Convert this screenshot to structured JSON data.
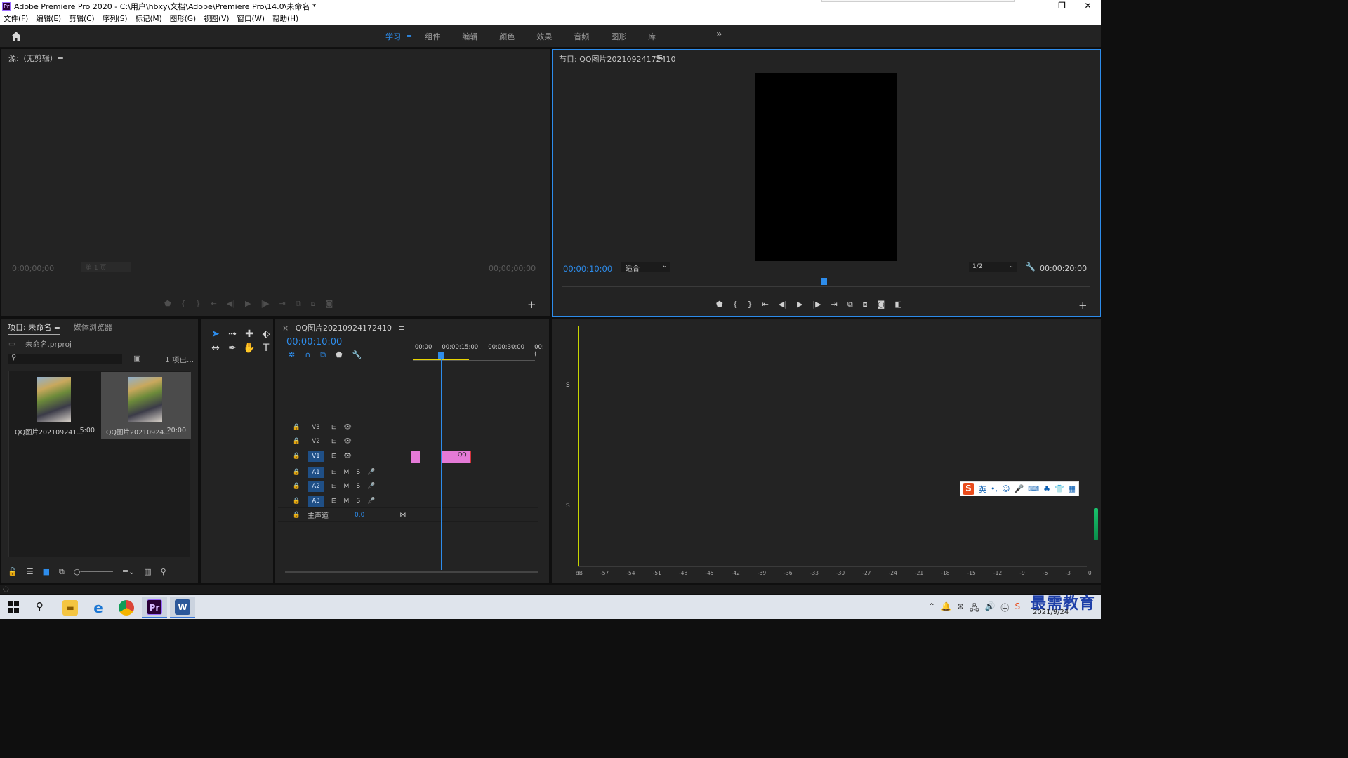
{
  "window": {
    "title": "Adobe Premiere Pro 2020 - C:\\用户\\hbxy\\文档\\Adobe\\Premiere Pro\\14.0\\未命名 *",
    "logo_text": "Pr"
  },
  "menu": [
    "文件(F)",
    "编辑(E)",
    "剪辑(C)",
    "序列(S)",
    "标记(M)",
    "图形(G)",
    "视图(V)",
    "窗口(W)",
    "帮助(H)"
  ],
  "workspaces": {
    "tabs": [
      "学习",
      "组件",
      "编辑",
      "颜色",
      "效果",
      "音频",
      "图形",
      "库"
    ],
    "active": "学习",
    "menu_glyph": "≡",
    "more": "»"
  },
  "source": {
    "title": "源:（无剪辑）≡",
    "timecode_in": "0;00;00;00",
    "timecode_out": "00;00;00;00",
    "page_dropdown": "第 1 页"
  },
  "program": {
    "title": "节目: QQ图片20210924172410",
    "timecode": "00:00:10:00",
    "zoom": "适合",
    "resolution": "1/2",
    "duration": "00:00:20:00",
    "playhead_fraction": 0.5
  },
  "project": {
    "tab_project": "项目: 未命名 ≡",
    "tab_media": "媒体浏览器",
    "file": "未命名.prproj",
    "count": "1 项已...",
    "clips": [
      {
        "name": "QQ图片202109241...",
        "duration": "5:00"
      },
      {
        "name": "QQ图片20210924...",
        "duration": "20:00"
      }
    ]
  },
  "timeline": {
    "tab": "QQ图片20210924172410",
    "timecode": "00:00:10:00",
    "ruler": [
      ":00:00",
      "00:00:15:00",
      "00:00:30:00",
      "00:("
    ],
    "tracks_video": [
      "V3",
      "V2",
      "V1"
    ],
    "tracks_audio": [
      "A1",
      "A2",
      "A3"
    ],
    "master_label": "主声道",
    "master_value": "0.0",
    "clip_label": "QQ"
  },
  "meters": {
    "solo_label": "S",
    "scale": [
      "dB",
      "-57",
      "-54",
      "-51",
      "-48",
      "-45",
      "-42",
      "-39",
      "-36",
      "-33",
      "-30",
      "-27",
      "-24",
      "-21",
      "-18",
      "-15",
      "-12",
      "-9",
      "-6",
      "-3",
      "0"
    ]
  },
  "ime": {
    "logo": "S",
    "lang": "英"
  },
  "taskbar": {
    "watermark": "最需教育",
    "date": "2021/9/24",
    "apps": [
      "file-explorer",
      "edge",
      "chrome",
      "premiere-pro",
      "word"
    ]
  }
}
